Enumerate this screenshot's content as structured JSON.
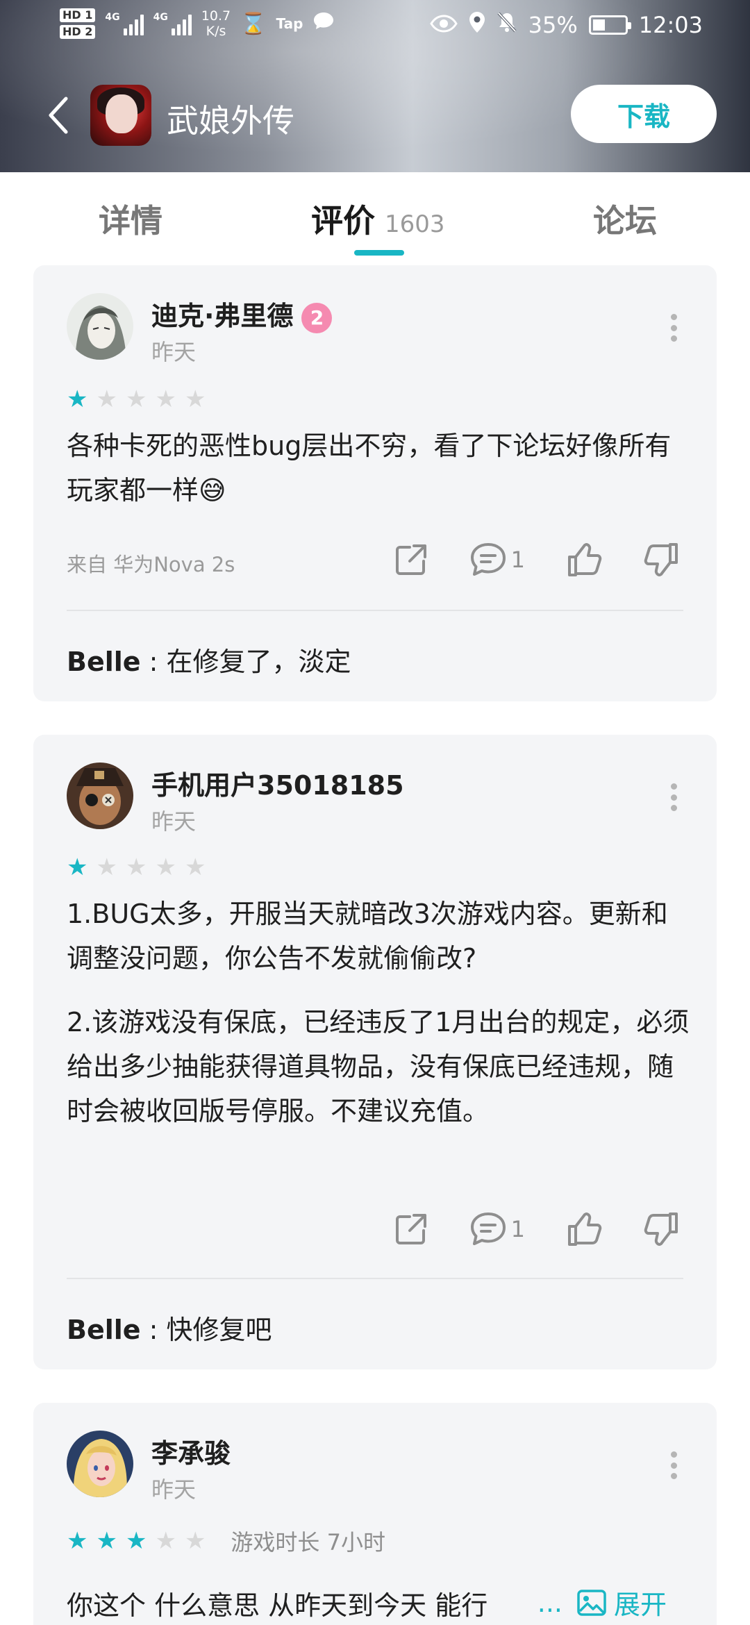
{
  "status_bar": {
    "hd1": "HD 1",
    "hd2": "HD 2",
    "net1": "4G",
    "net2": "4G",
    "speed_value": "10.7",
    "speed_unit": "K/s",
    "tap_label": "Tap",
    "battery": "35%",
    "time": "12:03"
  },
  "app": {
    "title": "武娘外传",
    "download_label": "下载",
    "back_icon": "chevron-left-icon",
    "icon": "game-app-icon"
  },
  "tabs": [
    {
      "label": "详情"
    },
    {
      "label": "评价",
      "count": "1603"
    },
    {
      "label": "论坛"
    }
  ],
  "colors": {
    "accent": "#19b6c4",
    "badge_pink": "#f58ab0",
    "card_bg": "#f4f5f7"
  },
  "reviews": [
    {
      "username": "迪克·弗里德",
      "level": "2",
      "time": "昨天",
      "rating": 1,
      "max_rating": 5,
      "text": [
        "各种卡死的恶性bug层出不穷，看了下论坛好像所有玩家都一样😅"
      ],
      "device": "来自 华为Nova 2s",
      "comment_count": "1",
      "reply": {
        "author": "Belle",
        "sep": " : ",
        "text": "在修复了，淡定"
      }
    },
    {
      "username": "手机用户35018185",
      "time": "昨天",
      "rating": 1,
      "max_rating": 5,
      "text": [
        "1.BUG太多，开服当天就暗改3次游戏内容。更新和调整没问题，你公告不发就偷偷改?",
        "2.该游戏没有保底，已经违反了1月出台的规定，必须给出多少抽能获得道具物品，没有保底已经违规，随时会被收回版号停服。不建议充值。"
      ],
      "comment_count": "1",
      "reply": {
        "author": "Belle",
        "sep": " : ",
        "text": "快修复吧"
      }
    },
    {
      "username": "李承骏",
      "time": "昨天",
      "rating": 3,
      "max_rating": 5,
      "playtime": "游戏时长 7小时",
      "text": [
        "你这个 什么意思 从昨天到今天 能行"
      ],
      "ellipsis": "...",
      "expand_label": "展开"
    }
  ]
}
